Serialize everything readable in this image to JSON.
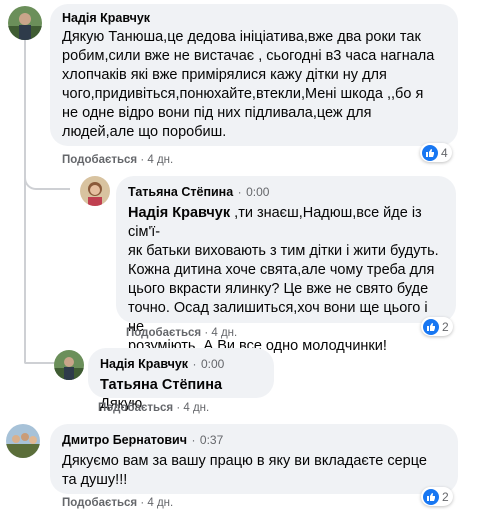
{
  "comments": [
    {
      "author": "Надія Кравчук",
      "time": "",
      "lines": [
        "Дякую Танюша,це дедова ініціатива,вже два роки так",
        "робим,сили вже не вистачає , сьогодні в3 часа нагнала",
        "хлопчаків які вже примірялися кажу дітки ну для",
        "чого,придивіться,понюхайте,втекли,Мені шкода ,,бо я",
        "не одне відро вони під них підливала,цеж для",
        "людей,але що поробиш."
      ],
      "like_label": "Подобається",
      "age": "4 дн.",
      "reactions": "4"
    },
    {
      "author": "Татьяна Стёпина",
      "time": "0:00",
      "mention": "Надія Кравчук",
      "lines": [
        " ,ти знаєш,Надюш,все йде із сім'ї-",
        "як батьки виховають з тим дітки і жити будуть.",
        "Кожна дитина хоче свята,але чому треба для",
        "цього вкрасти ялинку? Це вже не свято буде",
        "точно. Осад залишиться,хоч вони ще цього і не",
        "розуміють. А Ви все одно молодчинки!"
      ],
      "like_label": "Подобається",
      "age": "4 дн.",
      "reactions": "2"
    },
    {
      "author": "Надія Кравчук",
      "time": "0:00",
      "mention": "Татьяна Стёпина",
      "lines": [
        " Дякую"
      ],
      "like_label": "Подобається",
      "age": "4 дн."
    },
    {
      "author": "Дмитро Бернатович",
      "time": "0:37",
      "lines": [
        "Дякуємо вам за вашу працю в яку ви вкладаєте серце",
        "та душу!!!"
      ],
      "like_label": "Подобається",
      "age": "4 дн.",
      "reactions": "2"
    }
  ],
  "separator": "·",
  "colors": {
    "bubble": "#f0f2f5",
    "meta": "#65676b",
    "like_blue": "#1877f2"
  }
}
